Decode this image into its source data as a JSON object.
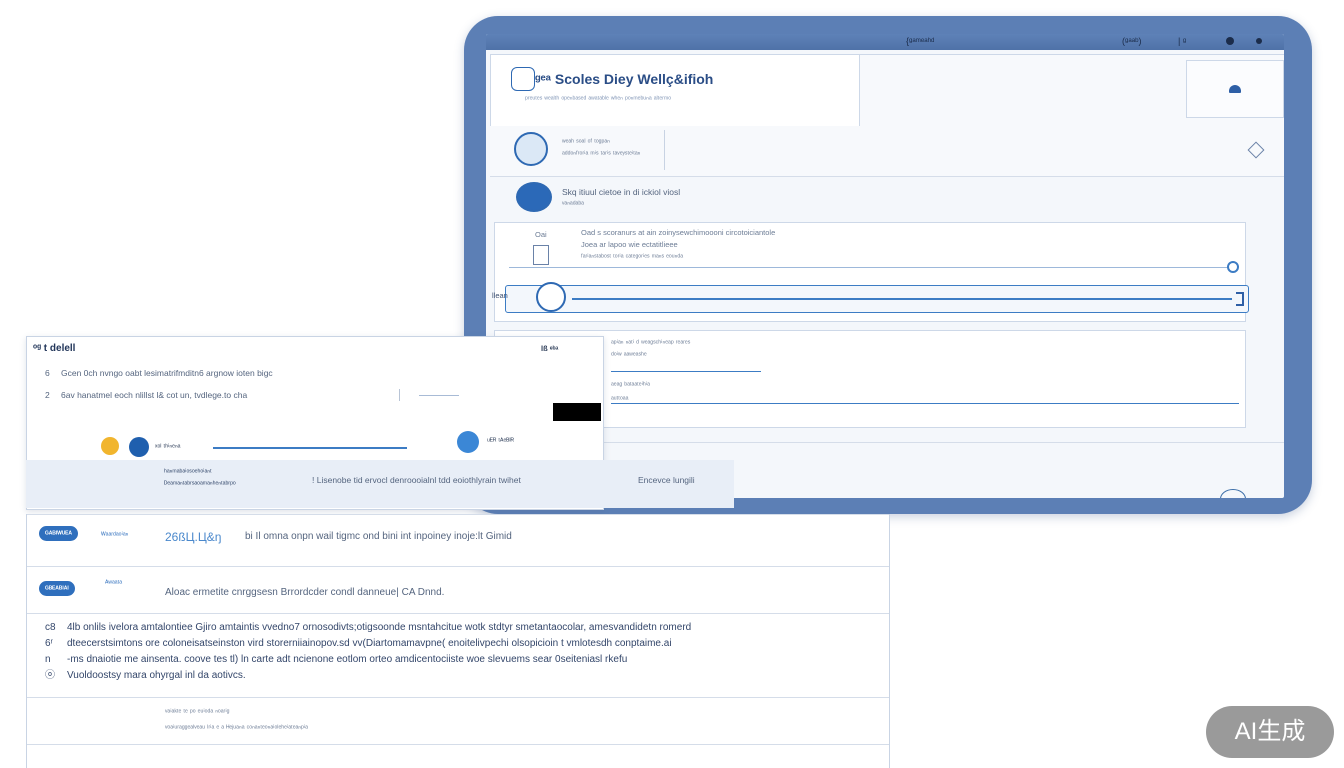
{
  "window": {
    "titlebar": {
      "center_text": "{ᵍᵃᵐᵉᵃʰᵈ",
      "right_text": "(ᵍᵃᵃᵇ)",
      "right_text2": "| ᵍ"
    },
    "app_title": "ᵍᵉᵃ Scoles Diey Wellç&ifioh",
    "app_subtitle": "ᵖʳᵉᵘᵗᵉˢ ʷᵉᵃˡᵗʰ ᵒᵖᵉⁿᵇᵃˢᵉᵈ ᵃʷᵃᵗᵃᵇˡᵉ ʷʰᵉⁿ ᵖᵒⁿᵐᵉᵇᵘⁿᵃ ᵃˡᵗᵉʳᵐᵒ",
    "item1": {
      "line1": "ʷᵉᵃʰ ˢᵒᵃˡ ᵒᶠ ᵗᵒᵍᵖᵃⁿ",
      "line2": "ᵃᵈᵈᵒⁿᶠʳᵒʳⁱᵃ ᵐⁱˢ ᵗᵃʳⁱˢ ᵗᵃᵛᵉʸˢᵗᵉⁱᵗᵃⁿ"
    },
    "item2": {
      "line1": "Skq itiuul cietoe in di ickiol viosl",
      "line2": "ᵛᵃⁿᵃᵈᵃᵇᵃ"
    },
    "card_a": {
      "label": "Oai",
      "line1": "Oad s scoranurs at ain zoinysewchimoooni circotoiciantole",
      "line2": "Joea ar lapoo wie ectatitlieee",
      "line3": "ᶠᵃʳⁱᵃⁿˢᵗᵃᵇᵒˢᵗ ᵗᵒʳⁱᵃ ᶜᵃᵗᵉᵍᵒʳⁱᵉˢ ᵐᵃⁿˢ ᵉᵒᵘⁿᵈᵃ"
    },
    "card_a_side": "llean",
    "card_b": {
      "line1": "ᵃᵖⁱᵃⁿ ⁿᵃᵗⁱ ᵈ ʷᵉᵃᵍˢᶜʰⁱⁿᵉᵃᵖ ʳᵉᵃʳᵉˢ",
      "line2": "ᵈᵒⁱʷ ᵃᵃʷᵉᵃˢʰᵉ",
      "line3": "ᵃᵉᵃᵍ ᵇᵃᵗᵃᵃᵗᵉⁱʰⁱᵃ",
      "line4": "ᵃᵘᵗᵗᵒᵃᵃ"
    }
  },
  "dialog": {
    "title": "ᵒᵍ t delell",
    "row1_num": "6",
    "row1_text": "Gcen 0ch nvngo oabt lesimatrifmditn6 argnow ioten bigc",
    "row2_num": "2",
    "row2_text": "6av hanatmel eoch nlillst l& cot un, tvdlege.to cha",
    "top_right": "lß ᵉᵇᵃ",
    "action1_text": "ˣᵒˡ ᵗʰⁱⁿᵉⁿᵃ",
    "action2_text": "ᵘᴱᴿ ᵗᴬᵉᴮᴵᴿ"
  },
  "strip": {
    "left_line1": "ʰᵃⁿᵐᵃᵇᵃⁱᵒˢᵒᵉʰᵒⁱᵃⁿᵗ",
    "left_line2": "ᴰᵉᵃᵐᵃⁿᵗᵃᵇʳˢᵃᵒᵃᵐᵃⁿʰᵉⁿᵗᵃᵇʳᵖᵒ",
    "text": "! Lisenobe tid ervocl denroooialnl tdd eoiothlyrain twihet",
    "right_text": "Encevce lungili"
  },
  "list": {
    "row1": {
      "badge": "ᴳᴬᴮᴵᵂᵁᴱᴬ",
      "tag": "ᵂᵃᵃʳᵈᵃᵒⁱᵃⁿ",
      "num": "26ßЦ.Ц&ŋ",
      "text": "bi Il omna onpn wail tigmc ond bini int inpoiney inoje:lt Gimid"
    },
    "row2": {
      "badge": "ᴳᴮᴱᴬᴮᴵᴬᴵ",
      "tag": "ᴬʷᵃᵃᵗᵃ",
      "text": "Aloac ermetite cnrggsesn Brrordcder condl danneue| CA Dnnd."
    },
    "notes": [
      {
        "icon": "c8",
        "text": "4lb onlils ivelora amtalontiee Gjiro amtaintis vvedno7 ornosodivts;otigsoonde msntahcitue wotk stdtyr smetantaocolar, amesvandidetn romerd"
      },
      {
        "icon": "6ʳ",
        "text": "dteecerstsimtons ore coloneisatseinston vird storerniiainopov.sd vv(Diartomamavpne( enoitelivpechi olsopicioin t vmlotesdh conptaime.ai"
      },
      {
        "icon": "n",
        "text": "-ms dnaiotie me ainsenta. coove tes tl) ln carte adt ncienone eotlom orteo amdicentociiste woe slevuems sear 0seiteniasl rkefu"
      },
      {
        "icon": "ⓞ",
        "text": "Vuoldoostsy mara ohyrgal inl da aotivcs."
      }
    ],
    "footer_line1": "ᵛᵃⁱᵃᵏᵗᵉ ᵗᵉ ᵖᵒ ᵉᵘⁱᵒᵈᵃ ⁿᵒᵃʳⁱᵍ",
    "footer_line2": "ᵛᵒᵃⁱᵘʳᵃᵍᵍᵉᵃˡᵛᵉᵃᵘ ˡʳⁱᵃ ᵉ ᵃ ᴴᵉʲᵘᵃⁿᵃ ᶜᵒⁿᵃⁿᵗᵉᵒⁿᵃⁱᵒˡᵉʰᵉⁱᵃᵗᵉᵃⁿᵖⁱᵃ"
  },
  "badge": {
    "label": "AI生成"
  },
  "colors": {
    "accent": "#2f6fbd",
    "frame": "#5c7fb5",
    "badge_yellow": "#f1b52e"
  }
}
